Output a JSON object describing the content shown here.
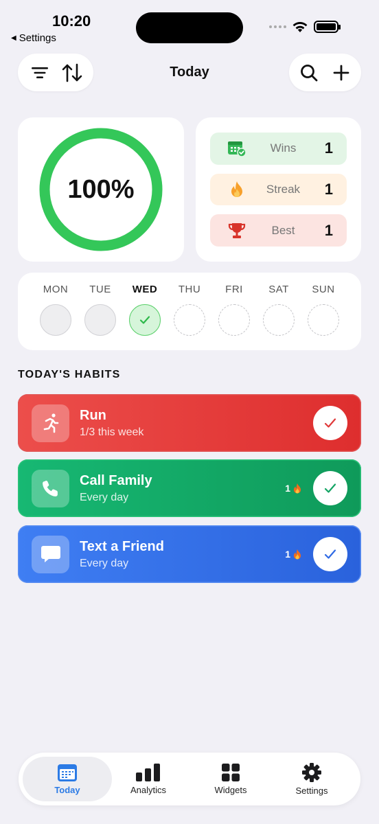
{
  "status": {
    "time": "10:20",
    "back_label": "Settings"
  },
  "header": {
    "title": "Today",
    "left_icons": [
      "filter-icon",
      "sort-icon"
    ],
    "right_icons": [
      "search-icon",
      "plus-icon"
    ]
  },
  "progress": {
    "percent_label": "100%",
    "fraction": 1.0,
    "ring_color": "#34C759"
  },
  "stats": [
    {
      "label": "Wins",
      "value": "1",
      "icon": "calendar-check-icon",
      "bg": "#E3F5E6"
    },
    {
      "label": "Streak",
      "value": "1",
      "icon": "flame-icon",
      "bg": "#FFF1E1"
    },
    {
      "label": "Best",
      "value": "1",
      "icon": "trophy-icon",
      "bg": "#FCE4E1"
    }
  ],
  "week": [
    {
      "label": "MON",
      "state": "past"
    },
    {
      "label": "TUE",
      "state": "past"
    },
    {
      "label": "WED",
      "state": "done",
      "today": true
    },
    {
      "label": "THU",
      "state": "future"
    },
    {
      "label": "FRI",
      "state": "future"
    },
    {
      "label": "SAT",
      "state": "future"
    },
    {
      "label": "SUN",
      "state": "future"
    }
  ],
  "habits_section_title": "TODAY'S HABITS",
  "habits": [
    {
      "name": "Run",
      "subtitle": "1/3 this week",
      "streak": "",
      "icon": "running-icon",
      "color": "#E53935",
      "completed": true
    },
    {
      "name": "Call Family",
      "subtitle": "Every day",
      "streak": "1",
      "icon": "phone-icon",
      "color": "#0FA865",
      "completed": true
    },
    {
      "name": "Text a Friend",
      "subtitle": "Every day",
      "streak": "1",
      "icon": "chat-bubble-icon",
      "color": "#3572EA",
      "completed": true
    }
  ],
  "tabs": [
    {
      "label": "Today",
      "icon": "calendar-icon",
      "active": true
    },
    {
      "label": "Analytics",
      "icon": "bar-chart-icon",
      "active": false
    },
    {
      "label": "Widgets",
      "icon": "grid-icon",
      "active": false
    },
    {
      "label": "Settings",
      "icon": "gear-icon",
      "active": false
    }
  ],
  "accent_color": "#2C7BE5"
}
